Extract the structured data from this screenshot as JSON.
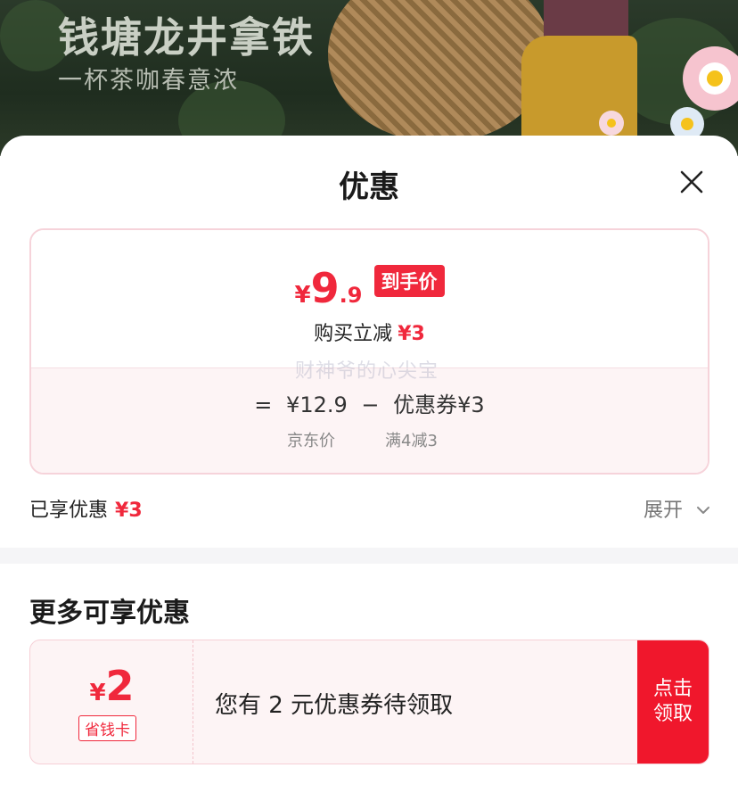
{
  "banner": {
    "title": "钱塘龙井拿铁",
    "subtitle": "一杯茶咖春意浓"
  },
  "sheet": {
    "title": "优惠",
    "close_icon": "close-icon"
  },
  "price_card": {
    "yen": "¥",
    "price_main": "9",
    "price_decimal": ".9",
    "price_tag": "到手价",
    "discount_label": "购买立减",
    "discount_amount": "¥3",
    "watermark": "财神爷的心尖宝",
    "formula": {
      "equals": "=",
      "base_price": "¥12.9",
      "minus": "−",
      "coupon_label": "优惠券¥3",
      "base_price_label": "京东价",
      "coupon_condition": "满4减3"
    }
  },
  "enjoyed": {
    "label": "已享优惠",
    "amount": "¥3",
    "expand_label": "展开",
    "expand_icon": "chevron-down-icon"
  },
  "more": {
    "title": "更多可享优惠",
    "coupon": {
      "yen": "¥",
      "value": "2",
      "type": "省钱卡",
      "text": "您有 2 元优惠券待领取",
      "claim_label": "点击领取"
    }
  },
  "colors": {
    "accent": "#f0283c",
    "card_border": "#f6d3da",
    "card_bg": "#fdf4f5",
    "divider": "#f5f5f7"
  }
}
